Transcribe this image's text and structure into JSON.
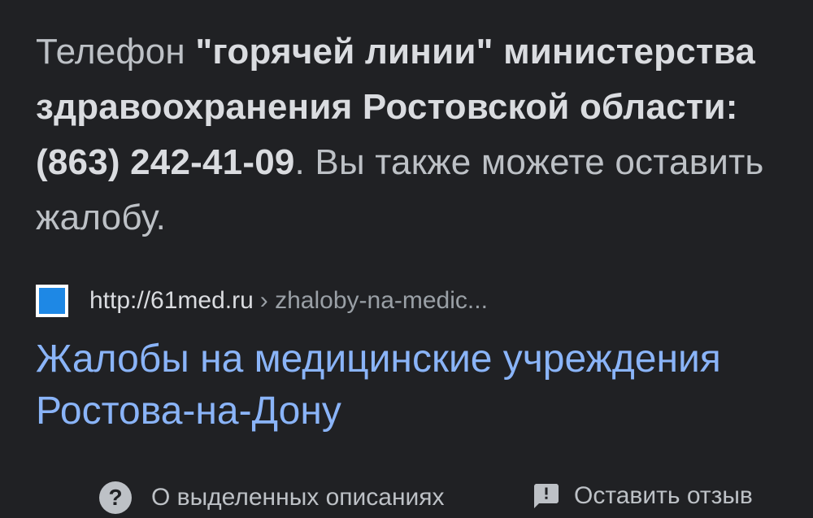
{
  "snippet": {
    "part1": "Телефон ",
    "bold1": "\"горячей линии\" министерства здравоохранения Ростовской области: (863) 242-41-09",
    "part2": ". Вы также можете оставить жалобу."
  },
  "result": {
    "url_domain": "http://61med.ru",
    "url_path": "› zhaloby-na-medic...",
    "title": "Жалобы на медицинские учреждения Ростова-на-Дону"
  },
  "footer": {
    "about_label": "О выделенных описаниях",
    "feedback_label": "Оставить отзыв"
  },
  "icons": {
    "favicon": "site-favicon",
    "about": "question-mark-icon",
    "feedback": "feedback-icon"
  },
  "colors": {
    "background": "#202124",
    "link": "#8ab4f8",
    "text": "#bdc1c6",
    "favicon": "#1e88e5"
  }
}
